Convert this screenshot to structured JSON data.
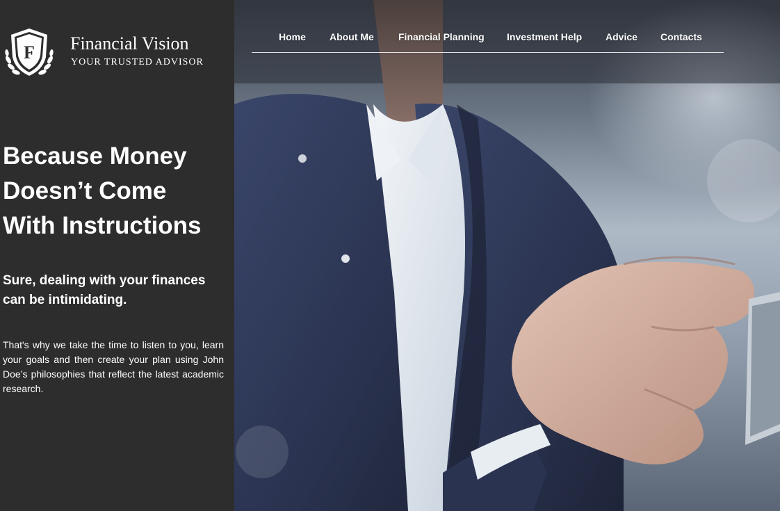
{
  "brand": {
    "name": "Financial Vision",
    "tagline": "YOUR TRUSTED ADVISOR",
    "crest_letter": "F"
  },
  "nav": {
    "items": [
      {
        "label": "Home"
      },
      {
        "label": "About Me"
      },
      {
        "label": "Financial Planning"
      },
      {
        "label": "Investment Help"
      },
      {
        "label": "Advice"
      },
      {
        "label": "Contacts"
      }
    ]
  },
  "hero": {
    "headline": "Because Money Doesn’t Come With Instructions",
    "subhead": "Sure, dealing with your finances can be intimidating.",
    "body": "That's why we take the time to listen to you, learn your goals and then create your plan using John Doe’s philosophies that reflect the latest academic research."
  },
  "colors": {
    "sidebar": "#2d2d2d",
    "text": "#ffffff",
    "suit": "#2f3a58",
    "shirt": "#dfe6ee"
  }
}
